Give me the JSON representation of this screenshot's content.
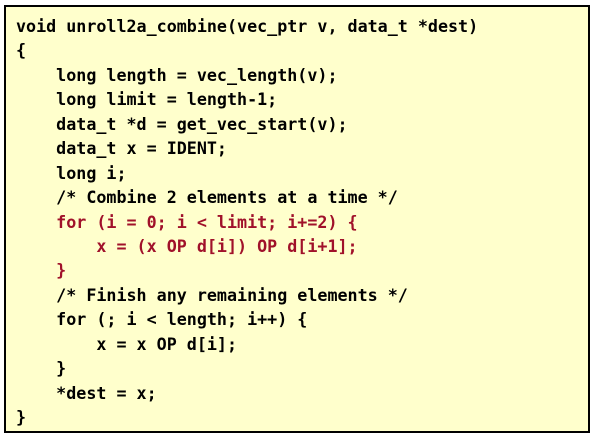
{
  "code": {
    "lines": [
      {
        "text": "void unroll2a_combine(vec_ptr v, data_t *dest)",
        "highlight": false
      },
      {
        "text": "{",
        "highlight": false
      },
      {
        "text": "    long length = vec_length(v);",
        "highlight": false
      },
      {
        "text": "    long limit = length-1;",
        "highlight": false
      },
      {
        "text": "    data_t *d = get_vec_start(v);",
        "highlight": false
      },
      {
        "text": "    data_t x = IDENT;",
        "highlight": false
      },
      {
        "text": "    long i;",
        "highlight": false
      },
      {
        "text": "    /* Combine 2 elements at a time */",
        "highlight": false
      },
      {
        "text": "    for (i = 0; i < limit; i+=2) {",
        "highlight": true
      },
      {
        "text": "        x = (x OP d[i]) OP d[i+1];",
        "highlight": true
      },
      {
        "text": "    }",
        "highlight": true
      },
      {
        "text": "    /* Finish any remaining elements */",
        "highlight": false
      },
      {
        "text": "    for (; i < length; i++) {",
        "highlight": false
      },
      {
        "text": "        x = x OP d[i];",
        "highlight": false
      },
      {
        "text": "    }",
        "highlight": false
      },
      {
        "text": "    *dest = x;",
        "highlight": false
      },
      {
        "text": "}",
        "highlight": false
      }
    ]
  },
  "colors": {
    "background": "#ffffcc",
    "text": "#000000",
    "highlight": "#a0112a",
    "border": "#000000"
  }
}
